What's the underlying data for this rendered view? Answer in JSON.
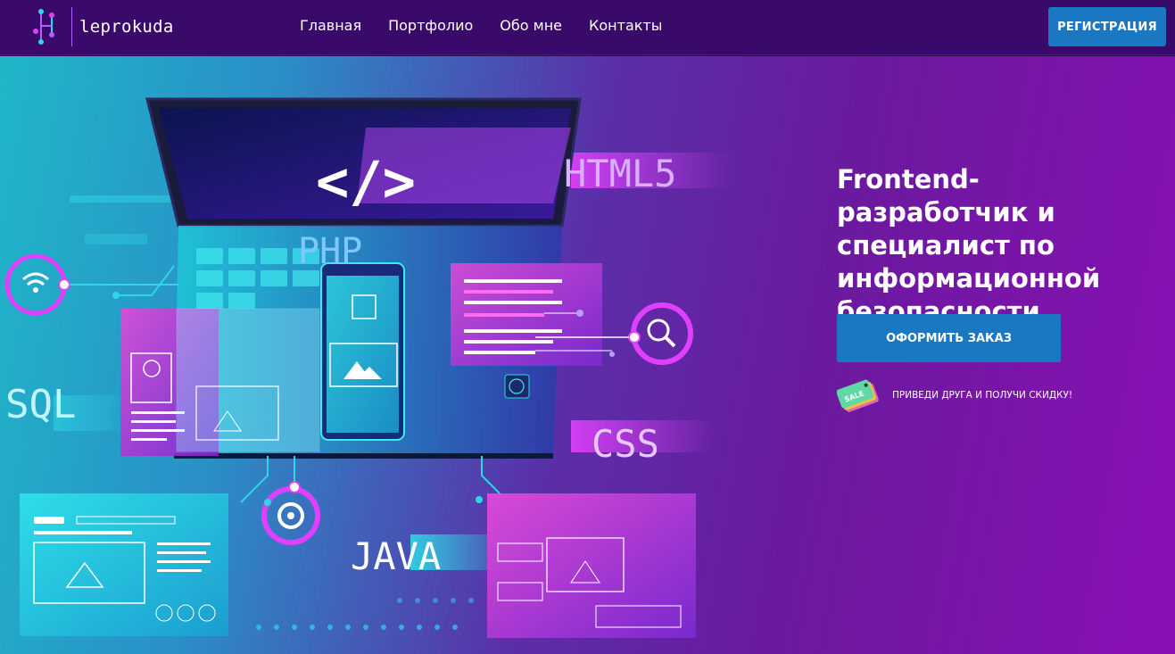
{
  "header": {
    "logo_text": "leprokuda",
    "nav": [
      "Главная",
      "Портфолио",
      "Обо мне",
      "Контакты"
    ],
    "register_label": "РЕГИСТРАЦИЯ"
  },
  "hero": {
    "headline": "Frontend-разработчик и специалист по информационной безопасности",
    "order_label": "ОФОРМИТЬ ЗАКАЗ",
    "sale_tag": "SALE",
    "promo_text": "ПРИВЕДИ ДРУГА И ПОЛУЧИ СКИДКУ!",
    "illustration_labels": {
      "code": "</>",
      "html": "HTML5",
      "php": "PHP",
      "sql": "SQL",
      "css": "CSS",
      "java": "JAVA"
    }
  },
  "colors": {
    "header_bg": "#3a0a6b",
    "button_blue": "#1a78c2",
    "neon_pink": "#e040fb",
    "cyan": "#2fd6e6"
  }
}
